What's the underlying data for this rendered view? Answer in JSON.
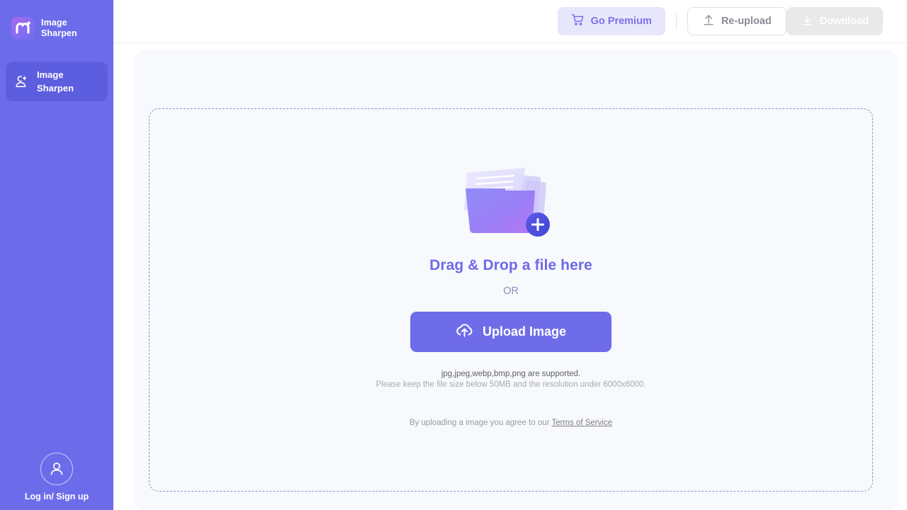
{
  "sidebar": {
    "brand": {
      "name": "Image\nSharpen",
      "logo_icon": "m-logo-icon"
    },
    "items": [
      {
        "label": "Image\nSharpen",
        "icon": "person-plus-icon",
        "active": true
      }
    ],
    "account": {
      "label": "Log in/ Sign up",
      "icon": "user-avatar-icon"
    },
    "color": "#6c6ceb",
    "active_color": "#5d5de0"
  },
  "topbar": {
    "go_premium": {
      "label": "Go Premium",
      "icon": "cart-icon",
      "color": "#7b72e8",
      "bg": "#e7e6fb"
    },
    "reupload": {
      "label": "Re-upload",
      "icon": "upload-arrow-icon"
    },
    "download": {
      "label": "Download",
      "icon": "download-arrow-icon",
      "disabled": true
    }
  },
  "dropzone": {
    "illustration_icon": "folder-add-icon",
    "title": "Drag & Drop a file here",
    "or": "OR",
    "upload_button": {
      "label": "Upload Image",
      "icon": "cloud-upload-icon",
      "bg": "#6e6ce9"
    },
    "hint_formats": "jpg,jpeg,webp,bmp,png are supported.",
    "hint_limits": "Please keep the file size below 50MB and the resolution under 6000x6000.",
    "tos_prefix": "By uploading a image you agree to our ",
    "tos_link": "Terms of Service"
  }
}
